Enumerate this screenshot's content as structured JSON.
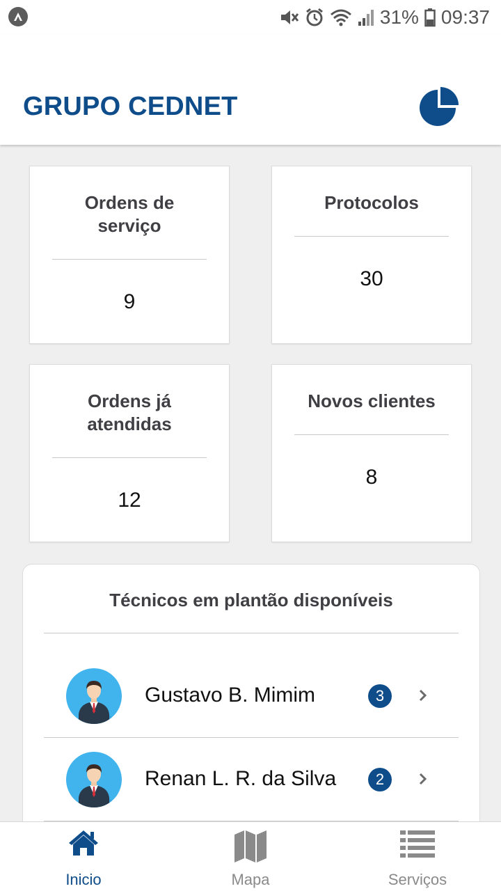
{
  "status_bar": {
    "battery": "31%",
    "time": "09:37"
  },
  "app": {
    "title": "GRUPO CEDNET",
    "colors": {
      "primary": "#0f4c8a",
      "avatar_bg": "#41b4ee",
      "background": "#efefef"
    }
  },
  "cards": [
    {
      "title": "Ordens de serviço",
      "value": "9"
    },
    {
      "title": "Protocolos",
      "value": "30"
    },
    {
      "title": "Ordens já atendidas",
      "value": "12"
    },
    {
      "title": "Novos clientes",
      "value": "8"
    }
  ],
  "technicians": {
    "title": "Técnicos em plantão disponíveis",
    "items": [
      {
        "name": "Gustavo B. Mimim",
        "count": "3"
      },
      {
        "name": "Renan L. R. da Silva",
        "count": "2"
      }
    ]
  },
  "bottom_nav": {
    "items": [
      {
        "label": "Inicio",
        "icon": "home-icon",
        "active": true
      },
      {
        "label": "Mapa",
        "icon": "map-icon",
        "active": false
      },
      {
        "label": "Serviços",
        "icon": "list-icon",
        "active": false
      }
    ]
  }
}
